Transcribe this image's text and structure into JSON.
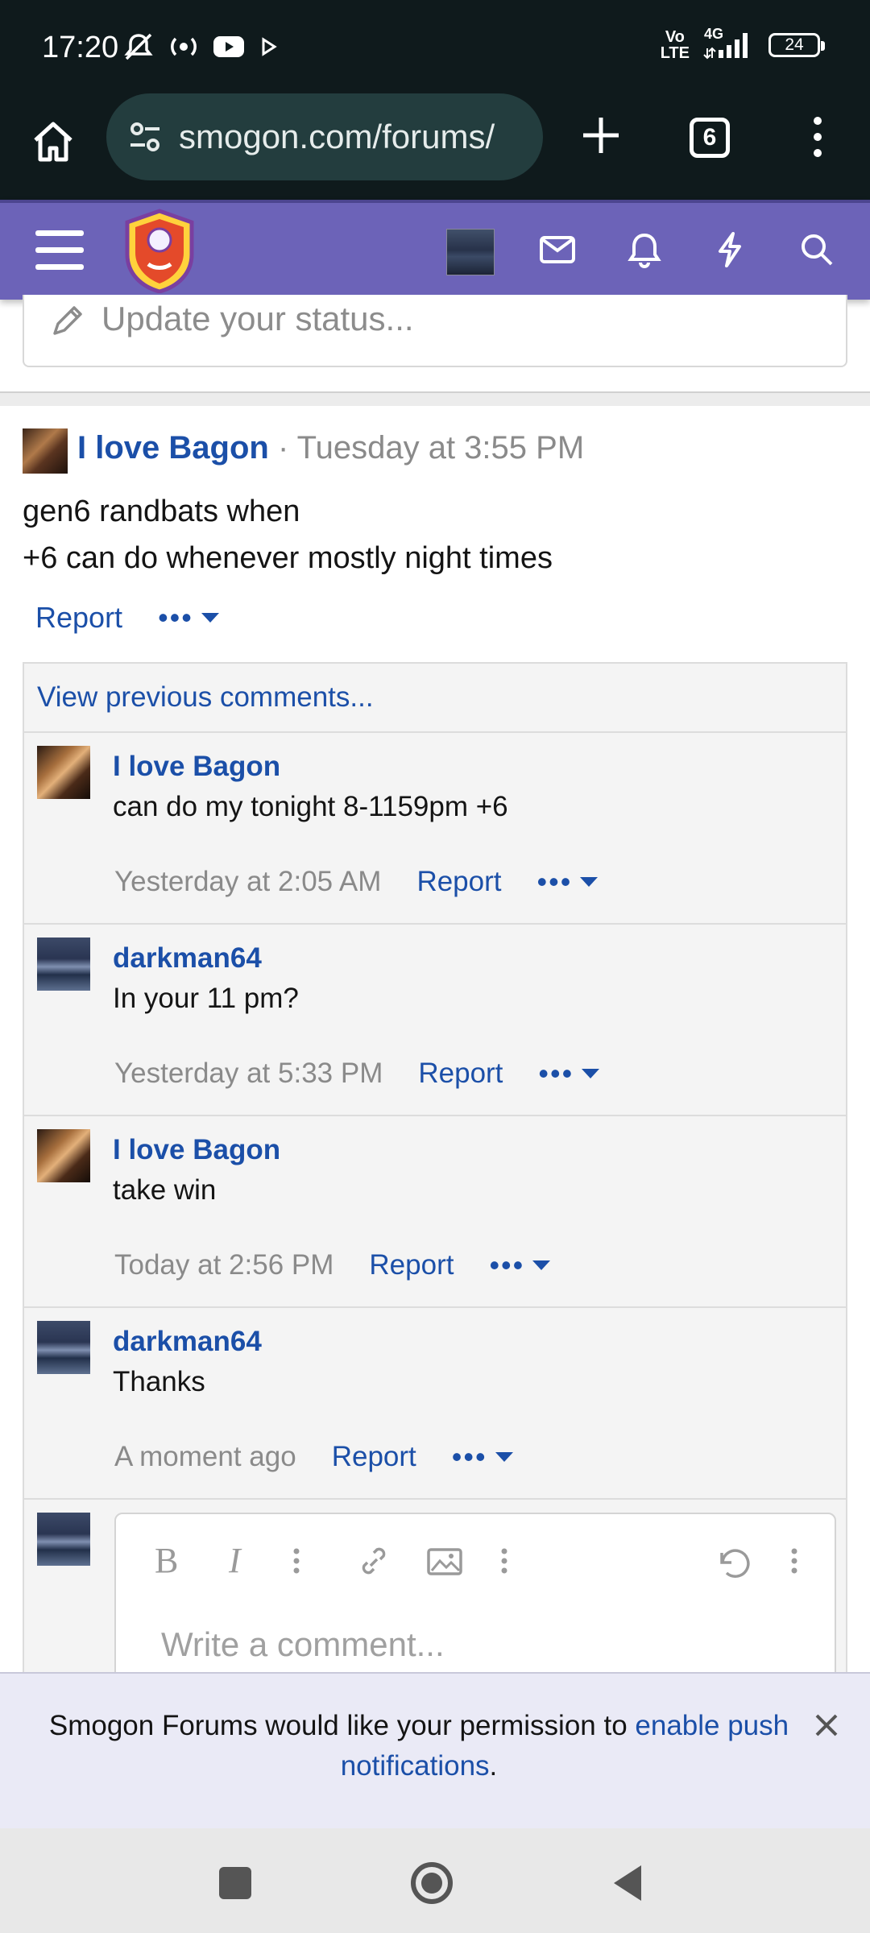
{
  "status_bar": {
    "time": "17:20",
    "network_top": "Vo",
    "network_bottom": "LTE",
    "network_type": "4G",
    "battery": "24"
  },
  "browser": {
    "url": "smogon.com/forums/",
    "tab_count": "6"
  },
  "forum_header": {
    "icons": [
      "menu-icon",
      "smogon-logo",
      "user-avatar",
      "mail-icon",
      "bell-icon",
      "lightning-icon",
      "search-icon"
    ]
  },
  "status_input": {
    "placeholder": "Update your status..."
  },
  "post": {
    "author": "I love Bagon",
    "separator": "·",
    "time": "Tuesday at 3:55 PM",
    "body_line1": "gen6 randbats when",
    "body_line2": "+6 can do whenever mostly night times",
    "report_label": "Report",
    "more_label": "•••"
  },
  "comments": {
    "view_previous": "View previous comments...",
    "items": [
      {
        "author": "I love Bagon",
        "text": "can do my tonight 8-1159pm +6",
        "time": "Yesterday at 2:05 AM",
        "report": "Report",
        "more": "•••"
      },
      {
        "author": "darkman64",
        "text": "In your 11 pm?",
        "time": "Yesterday at 5:33 PM",
        "report": "Report",
        "more": "•••"
      },
      {
        "author": "I love Bagon",
        "text": "take win",
        "time": "Today at 2:56 PM",
        "report": "Report",
        "more": "•••"
      },
      {
        "author": "darkman64",
        "text": "Thanks",
        "time": "A moment ago",
        "report": "Report",
        "more": "•••"
      }
    ],
    "editor_placeholder": "Write a comment..."
  },
  "push_banner": {
    "text_before": "Smogon Forums would like your permission to ",
    "link_text": "enable push notifications",
    "text_after": "."
  },
  "colors": {
    "header_purple": "#6c63b8",
    "link_blue": "#1b4fa8",
    "chrome_dark": "#0f1a1c"
  }
}
